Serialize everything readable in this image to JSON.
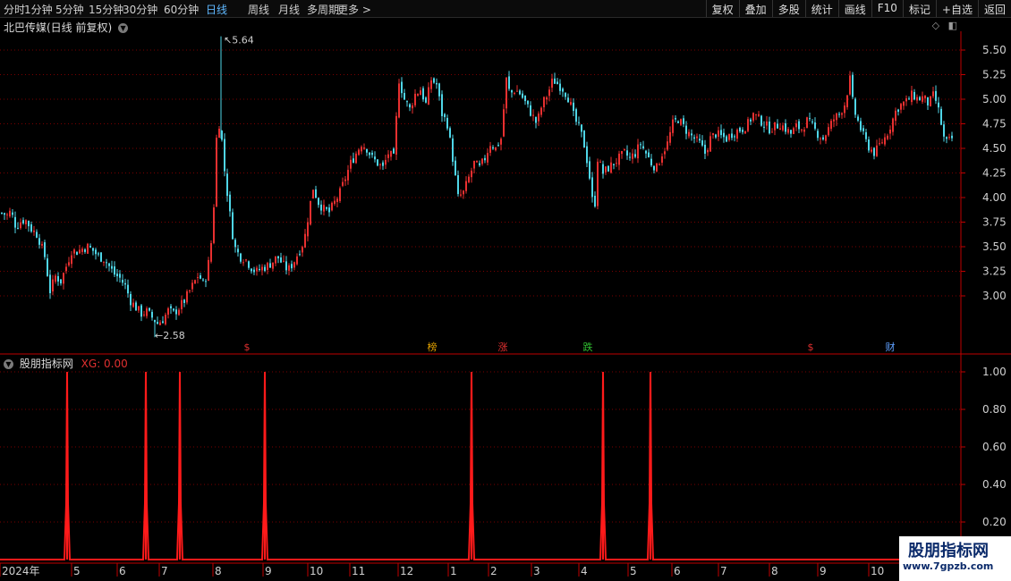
{
  "toolbar": {
    "periods": [
      "分时",
      "1分钟",
      "5分钟",
      "15分钟",
      "30分钟",
      "60分钟",
      "日线",
      "周线",
      "月线",
      "多周期",
      "更多 >"
    ],
    "active_period": "日线",
    "right_buttons": [
      "复权",
      "叠加",
      "多股",
      "统计",
      "画线",
      "F10",
      "标记",
      "+自选",
      "返回"
    ]
  },
  "main": {
    "title": "北巴传媒(日线 前复权)",
    "high_label": "5.64",
    "low_label": "2.58",
    "event_markers": [
      {
        "label": "$",
        "color": "#e03030"
      },
      {
        "label": "榜",
        "color": "#e0a000"
      },
      {
        "label": "涨",
        "color": "#e03030"
      },
      {
        "label": "跌",
        "color": "#30c030"
      },
      {
        "label": "$",
        "color": "#e03030"
      },
      {
        "label": "财",
        "color": "#5fa0ff"
      }
    ]
  },
  "indicator": {
    "name": "股朋指标网",
    "value_text": "XG: 0.00"
  },
  "watermark": {
    "line1": "股朋指标网",
    "line2": "www.7gpzb.com"
  },
  "colors": {
    "up": "#e83030",
    "down": "#4fd6e8",
    "grid": "#7a0000",
    "axis": "#c00000",
    "signal": "#ff1a1a",
    "label": "#d0d0d0"
  },
  "chart_data": [
    {
      "type": "candlestick",
      "title": "北巴传媒(日线 前复权)",
      "ylim": [
        2.55,
        5.7
      ],
      "y_ticks": [
        "5.50",
        "5.25",
        "5.00",
        "4.75",
        "4.50",
        "4.25",
        "4.00",
        "3.75",
        "3.50",
        "3.25",
        "3.00"
      ],
      "x_ticks": [
        "2024年",
        "5",
        "6",
        "7",
        "8",
        "9",
        "10",
        "11",
        "12",
        "1",
        "2",
        "3",
        "4",
        "5",
        "6",
        "7",
        "8",
        "9",
        "10"
      ],
      "annotated_high": 5.64,
      "annotated_low": 2.58,
      "close_path": [
        [
          0,
          3.85
        ],
        [
          8,
          3.82
        ],
        [
          12,
          3.86
        ],
        [
          18,
          3.7
        ],
        [
          22,
          3.75
        ],
        [
          28,
          3.78
        ],
        [
          35,
          3.68
        ],
        [
          42,
          3.62
        ],
        [
          50,
          3.4
        ],
        [
          56,
          3.05
        ],
        [
          62,
          3.2
        ],
        [
          68,
          3.15
        ],
        [
          74,
          3.3
        ],
        [
          80,
          3.46
        ],
        [
          86,
          3.45
        ],
        [
          92,
          3.48
        ],
        [
          98,
          3.5
        ],
        [
          104,
          3.46
        ],
        [
          110,
          3.4
        ],
        [
          116,
          3.38
        ],
        [
          122,
          3.3
        ],
        [
          128,
          3.22
        ],
        [
          134,
          3.18
        ],
        [
          140,
          3.1
        ],
        [
          146,
          2.95
        ],
        [
          152,
          2.88
        ],
        [
          158,
          2.82
        ],
        [
          164,
          2.84
        ],
        [
          170,
          2.78
        ],
        [
          176,
          2.72
        ],
        [
          182,
          2.76
        ],
        [
          188,
          2.85
        ],
        [
          194,
          2.82
        ],
        [
          200,
          2.88
        ],
        [
          206,
          2.95
        ],
        [
          212,
          3.05
        ],
        [
          218,
          3.15
        ],
        [
          222,
          3.22
        ],
        [
          228,
          3.1
        ],
        [
          234,
          3.38
        ],
        [
          238,
          3.7
        ],
        [
          242,
          4.6
        ],
        [
          246,
          4.8
        ],
        [
          250,
          4.35
        ],
        [
          254,
          4.05
        ],
        [
          258,
          3.75
        ],
        [
          262,
          3.5
        ],
        [
          268,
          3.4
        ],
        [
          274,
          3.38
        ],
        [
          280,
          3.3
        ],
        [
          286,
          3.24
        ],
        [
          292,
          3.28
        ],
        [
          298,
          3.3
        ],
        [
          304,
          3.34
        ],
        [
          310,
          3.4
        ],
        [
          316,
          3.32
        ],
        [
          322,
          3.26
        ],
        [
          328,
          3.34
        ],
        [
          334,
          3.45
        ],
        [
          340,
          3.56
        ],
        [
          346,
          3.9
        ],
        [
          350,
          4.1
        ],
        [
          356,
          3.95
        ],
        [
          362,
          3.88
        ],
        [
          368,
          3.85
        ],
        [
          374,
          3.95
        ],
        [
          380,
          4.05
        ],
        [
          386,
          4.2
        ],
        [
          392,
          4.35
        ],
        [
          398,
          4.45
        ],
        [
          404,
          4.55
        ],
        [
          410,
          4.5
        ],
        [
          416,
          4.4
        ],
        [
          422,
          4.35
        ],
        [
          428,
          4.3
        ],
        [
          434,
          4.45
        ],
        [
          440,
          4.4
        ],
        [
          446,
          5.2
        ],
        [
          452,
          5.0
        ],
        [
          458,
          4.9
        ],
        [
          464,
          5.05
        ],
        [
          470,
          5.1
        ],
        [
          476,
          4.95
        ],
        [
          482,
          5.2
        ],
        [
          488,
          5.15
        ],
        [
          494,
          4.85
        ],
        [
          500,
          4.75
        ],
        [
          506,
          4.4
        ],
        [
          512,
          4.0
        ],
        [
          518,
          4.05
        ],
        [
          524,
          4.2
        ],
        [
          530,
          4.35
        ],
        [
          536,
          4.3
        ],
        [
          542,
          4.4
        ],
        [
          548,
          4.55
        ],
        [
          554,
          4.5
        ],
        [
          560,
          4.6
        ],
        [
          566,
          5.2
        ],
        [
          570,
          5.05
        ],
        [
          576,
          5.1
        ],
        [
          582,
          5.05
        ],
        [
          588,
          4.95
        ],
        [
          594,
          4.85
        ],
        [
          600,
          4.75
        ],
        [
          606,
          4.95
        ],
        [
          612,
          5.05
        ],
        [
          618,
          5.2
        ],
        [
          624,
          5.15
        ],
        [
          630,
          5.1
        ],
        [
          636,
          5.0
        ],
        [
          642,
          4.8
        ],
        [
          648,
          4.7
        ],
        [
          654,
          4.5
        ],
        [
          660,
          4.15
        ],
        [
          664,
          3.8
        ],
        [
          668,
          4.4
        ],
        [
          674,
          4.25
        ],
        [
          680,
          4.3
        ],
        [
          686,
          4.35
        ],
        [
          692,
          4.4
        ],
        [
          698,
          4.45
        ],
        [
          704,
          4.4
        ],
        [
          710,
          4.45
        ],
        [
          716,
          4.55
        ],
        [
          722,
          4.45
        ],
        [
          728,
          4.35
        ],
        [
          734,
          4.3
        ],
        [
          740,
          4.45
        ],
        [
          746,
          4.55
        ],
        [
          752,
          4.75
        ],
        [
          758,
          4.8
        ],
        [
          764,
          4.72
        ],
        [
          770,
          4.65
        ],
        [
          776,
          4.6
        ],
        [
          782,
          4.55
        ],
        [
          788,
          4.45
        ],
        [
          794,
          4.6
        ],
        [
          800,
          4.65
        ],
        [
          806,
          4.62
        ],
        [
          812,
          4.6
        ],
        [
          818,
          4.65
        ],
        [
          824,
          4.68
        ],
        [
          830,
          4.7
        ],
        [
          836,
          4.75
        ],
        [
          842,
          4.85
        ],
        [
          848,
          4.8
        ],
        [
          854,
          4.75
        ],
        [
          860,
          4.7
        ],
        [
          866,
          4.72
        ],
        [
          872,
          4.75
        ],
        [
          878,
          4.7
        ],
        [
          884,
          4.65
        ],
        [
          890,
          4.72
        ],
        [
          896,
          4.7
        ],
        [
          902,
          4.78
        ],
        [
          908,
          4.72
        ],
        [
          914,
          4.65
        ],
        [
          920,
          4.6
        ],
        [
          926,
          4.7
        ],
        [
          932,
          4.8
        ],
        [
          938,
          4.85
        ],
        [
          944,
          4.95
        ],
        [
          950,
          5.2
        ],
        [
          954,
          4.9
        ],
        [
          960,
          4.75
        ],
        [
          966,
          4.6
        ],
        [
          972,
          4.5
        ],
        [
          978,
          4.45
        ],
        [
          984,
          4.55
        ],
        [
          990,
          4.62
        ],
        [
          996,
          4.75
        ],
        [
          1002,
          4.9
        ],
        [
          1008,
          4.95
        ],
        [
          1014,
          4.98
        ],
        [
          1020,
          5.05
        ],
        [
          1026,
          5.0
        ],
        [
          1032,
          5.02
        ],
        [
          1038,
          4.95
        ],
        [
          1044,
          5.05
        ],
        [
          1050,
          4.85
        ],
        [
          1056,
          4.55
        ],
        [
          1062,
          4.58
        ],
        [
          1066,
          4.62
        ]
      ]
    },
    {
      "type": "line",
      "series": [
        {
          "name": "XG",
          "x_positions": [
            75,
            163,
            201,
            296,
            527,
            674,
            727
          ],
          "peak": 1.0
        }
      ],
      "ylim": [
        0,
        1.05
      ],
      "y_ticks": [
        "1.00",
        "0.80",
        "0.60",
        "0.40",
        "0.20"
      ],
      "current_value": 0.0
    }
  ]
}
